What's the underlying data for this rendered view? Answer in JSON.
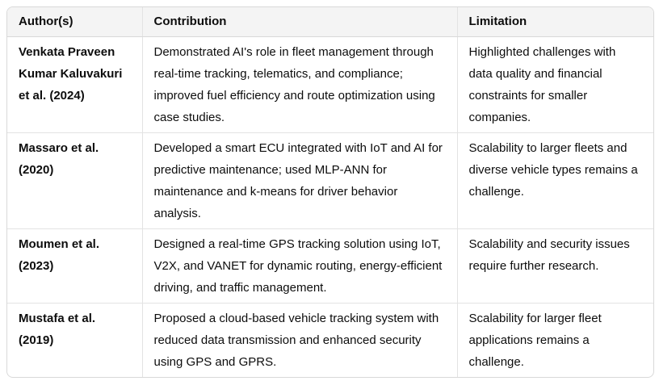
{
  "table": {
    "headers": [
      "Author(s)",
      "Contribution",
      "Limitation"
    ],
    "rows": [
      {
        "author": "Venkata Praveen Kumar Kaluvakuri et al. (2024)",
        "contribution": "Demonstrated AI's role in fleet management through real-time tracking, telematics, and compliance; improved fuel efficiency and route optimization using case studies.",
        "limitation": "Highlighted challenges with data quality and financial constraints for smaller companies."
      },
      {
        "author": "Massaro et al. (2020)",
        "contribution": "Developed a smart ECU integrated with IoT and AI for predictive maintenance; used MLP-ANN for maintenance and k-means for driver behavior analysis.",
        "limitation": "Scalability to larger fleets and diverse vehicle types remains a challenge."
      },
      {
        "author": "Moumen et al. (2023)",
        "contribution": "Designed a real-time GPS tracking solution using IoT, V2X, and VANET for dynamic routing, energy-efficient driving, and traffic management.",
        "limitation": "Scalability and security issues require further research."
      },
      {
        "author": "Mustafa et al. (2019)",
        "contribution": "Proposed a cloud-based vehicle tracking system with reduced data transmission and enhanced security using GPS and GPRS.",
        "limitation": "Scalability for larger fleet applications remains a challenge."
      }
    ]
  }
}
